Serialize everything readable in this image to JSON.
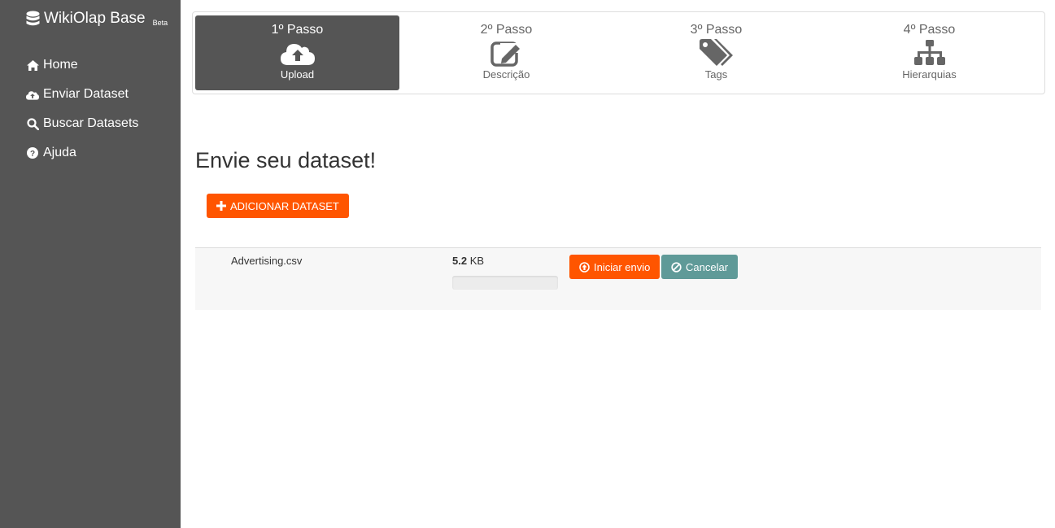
{
  "brand": {
    "title": "WikiOlap Base",
    "badge": "Beta",
    "icon": "database-icon"
  },
  "sidebar": {
    "items": [
      {
        "label": "Home",
        "icon": "home-icon"
      },
      {
        "label": "Enviar Dataset",
        "icon": "cloud-upload-icon"
      },
      {
        "label": "Buscar Datasets",
        "icon": "search-icon"
      },
      {
        "label": "Ajuda",
        "icon": "question-circle-icon"
      }
    ]
  },
  "wizard": {
    "steps": [
      {
        "title": "1º Passo",
        "label": "Upload",
        "icon": "cloud-upload-icon",
        "active": true
      },
      {
        "title": "2º Passo",
        "label": "Descrição",
        "icon": "edit-icon",
        "active": false
      },
      {
        "title": "3º Passo",
        "label": "Tags",
        "icon": "tags-icon",
        "active": false
      },
      {
        "title": "4º Passo",
        "label": "Hierarquias",
        "icon": "sitemap-icon",
        "active": false
      }
    ]
  },
  "main": {
    "title": "Envie seu dataset!",
    "add_button": "ADICIONAR DATASET",
    "file": {
      "name": "Advertising.csv",
      "size_value": "5.2",
      "size_unit": "KB",
      "progress": 0,
      "start_button": "Iniciar envio",
      "cancel_button": "Cancelar"
    }
  },
  "colors": {
    "sidebar_bg": "#555555",
    "accent": "#ff5500",
    "cancel": "#5f9a98",
    "step_active_bg": "#555555"
  }
}
